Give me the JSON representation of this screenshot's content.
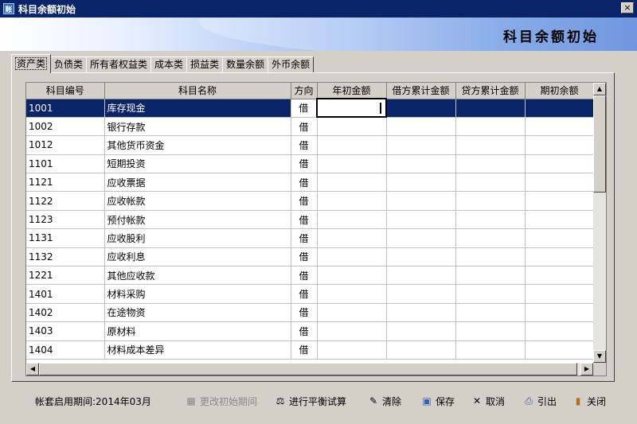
{
  "window": {
    "title": "科目余额初始",
    "close_glyph": "×"
  },
  "banner": {
    "title": "科目余额初始"
  },
  "tabs": [
    {
      "label": "资产类",
      "active": true
    },
    {
      "label": "负债类",
      "active": false
    },
    {
      "label": "所有者权益类",
      "active": false
    },
    {
      "label": "成本类",
      "active": false
    },
    {
      "label": "损益类",
      "active": false
    },
    {
      "label": "数量余额",
      "active": false
    },
    {
      "label": "外币余额",
      "active": false
    }
  ],
  "table": {
    "columns": [
      "科目编号",
      "科目名称",
      "方向",
      "年初金额",
      "借方累计金额",
      "贷方累计金额",
      "期初余额"
    ],
    "rows": [
      {
        "code": "1001",
        "name": "库存现金",
        "dir": "借"
      },
      {
        "code": "1002",
        "name": "银行存款",
        "dir": "借"
      },
      {
        "code": "1012",
        "name": "其他货币资金",
        "dir": "借"
      },
      {
        "code": "1101",
        "name": "短期投资",
        "dir": "借"
      },
      {
        "code": "1121",
        "name": "应收票据",
        "dir": "借"
      },
      {
        "code": "1122",
        "name": "应收帐款",
        "dir": "借"
      },
      {
        "code": "1123",
        "name": "预付帐款",
        "dir": "借"
      },
      {
        "code": "1131",
        "name": "应收股利",
        "dir": "借"
      },
      {
        "code": "1132",
        "name": "应收利息",
        "dir": "借"
      },
      {
        "code": "1221",
        "name": "其他应收款",
        "dir": "借"
      },
      {
        "code": "1401",
        "name": "材料采购",
        "dir": "借"
      },
      {
        "code": "1402",
        "name": "在途物资",
        "dir": "借"
      },
      {
        "code": "1403",
        "name": "原材料",
        "dir": "借"
      },
      {
        "code": "1404",
        "name": "材料成本差异",
        "dir": "借"
      }
    ]
  },
  "status": {
    "period_text": "帐套启用期间:2014年03月"
  },
  "toolbar": {
    "change_period": "更改初始期间",
    "trial_balance": "进行平衡试算",
    "clear": "清除",
    "save": "保存",
    "cancel": "取消",
    "export": "引出",
    "close": "关闭"
  },
  "icons": {
    "app": "accounting-app-icon",
    "change_period": "calculator-icon",
    "trial_balance": "balance-icon",
    "clear": "eraser-icon",
    "save": "floppy-disk-icon",
    "cancel": "x-cross-icon",
    "export": "export-icon",
    "close": "door-exit-icon"
  },
  "colors": {
    "titlebar": "#0a246a",
    "selection": "#0a246a",
    "chrome": "#d4d0c8",
    "banner_dark": "#3f74d4"
  }
}
